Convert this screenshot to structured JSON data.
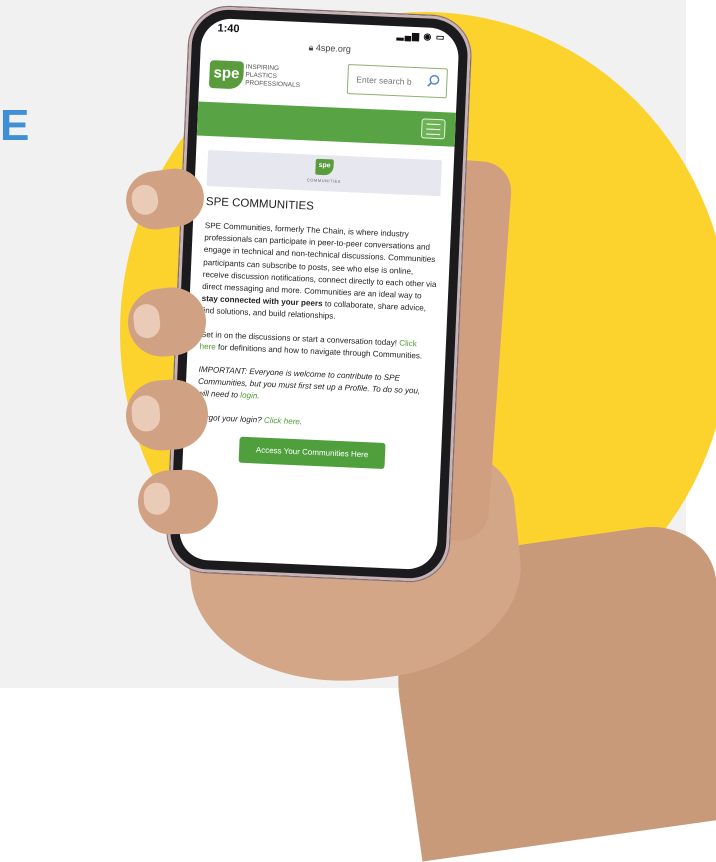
{
  "left_edge_text": "E",
  "phone": {
    "status_time": "1:40",
    "url": "4spe.org",
    "logo": "spe",
    "tagline": [
      "INSPIRING",
      "PLASTICS",
      "PROFESSIONALS"
    ],
    "search_placeholder": "Enter search b",
    "banner_logo": "spe",
    "banner_caption": "COMMUNITIES",
    "page_title": "SPE COMMUNITIES",
    "para1_before_bold": "SPE Communities, formerly The Chain, is where industry professionals can participate in peer-to-peer conversations and engage in technical and non-technical discussions. Communities participants can subscribe to posts, see who else is online, receive discussion notifications, connect directly to each other via direct messaging and more. Communities are an ideal way to ",
    "para1_bold": "stay connected with your peers",
    "para1_after_bold": " to collaborate, share advice, find solutions, and build relationships.",
    "para2_before_link": "Get in on the discussions or start a conversation today! ",
    "para2_link": "Click here",
    "para2_after_link": " for definitions and how to navigate through Communities.",
    "para3_text": "IMPORTANT: Everyone is welcome to contribute to SPE Communities, but you must first set up a Profile. To do so you, will need to ",
    "para3_link": "login",
    "para3_end": ".",
    "para4_text": "Forgot your login? ",
    "para4_link": "Click here",
    "para4_end": ".",
    "cta_label": "Access Your Communities Here"
  },
  "colors": {
    "brand_green": "#58a444",
    "sun_yellow": "#fcd22d",
    "accent_blue": "#3e8fd6"
  }
}
